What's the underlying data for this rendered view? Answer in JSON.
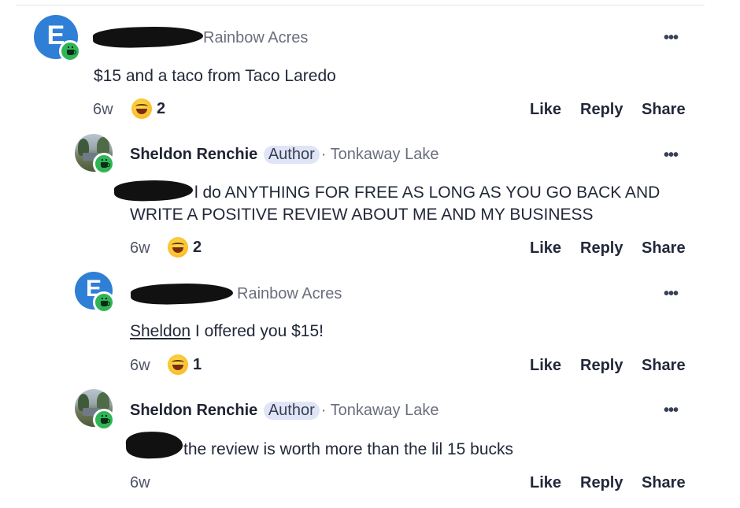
{
  "comments": [
    {
      "avatar_letter": "E",
      "name": "",
      "author_badge": "",
      "location": "Rainbow Acres",
      "text": "$15 and a taco from Taco Laredo",
      "age": "6w",
      "reaction_count": "2"
    },
    {
      "avatar_letter": "",
      "name": "Sheldon Renchie",
      "author_badge": "Author",
      "location": "Tonkaway Lake",
      "text_line1": "l do ANYTHING FOR FREE AS LONG AS YOU GO BACK AND",
      "text_line2": "WRITE A POSITIVE REVIEW ABOUT ME AND MY BUSINESS",
      "age": "6w",
      "reaction_count": "2"
    },
    {
      "avatar_letter": "E",
      "name": "",
      "author_badge": "",
      "location": "Rainbow Acres",
      "mention": "Sheldon",
      "text": " I offered you $15!",
      "age": "6w",
      "reaction_count": "1"
    },
    {
      "avatar_letter": "",
      "name": "Sheldon Renchie",
      "author_badge": "Author",
      "location": "Tonkaway Lake",
      "text": "the review is worth more than the lil 15 bucks",
      "age": "6w",
      "reaction_count": ""
    }
  ],
  "actions": {
    "like": "Like",
    "reply": "Reply",
    "share": "Share"
  },
  "more_glyph": "•••",
  "separator": "· ",
  "icons": {
    "badge": "coffee-cup-icon",
    "reaction": "grinning-face-emoji",
    "more": "more-options-icon"
  },
  "colors": {
    "badge_green": "#2fb456",
    "avatar_blue": "#2f7fd6",
    "author_pill": "#dfe5f7"
  }
}
